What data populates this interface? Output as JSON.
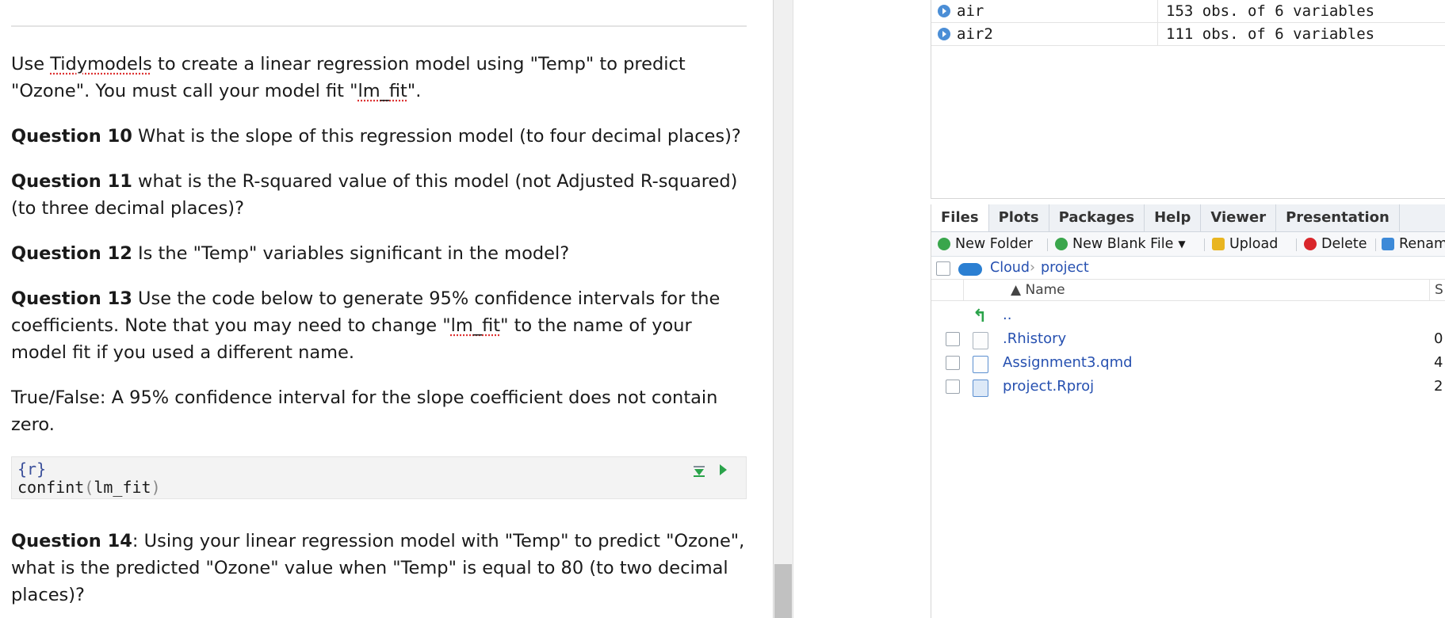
{
  "editor": {
    "intro_part1": "Use ",
    "intro_link": "Tidymodels",
    "intro_part2": " to create a linear regression model using \"Temp\" to predict \"Ozone\". You must call your model fit \"",
    "intro_lm": "lm_fit",
    "intro_part3": "\".",
    "q10_label": "Question 10",
    "q10_text": " What is the slope of this regression model (to four decimal places)?",
    "q11_label": "Question 11",
    "q11_text": " what is the R-squared value of this model (not Adjusted R-squared) (to three decimal places)?",
    "q12_label": "Question 12",
    "q12_text": " Is the \"Temp\" variables significant in the model?",
    "q13_label": "Question 13",
    "q13_part1": " Use the code below to generate 95% confidence intervals for the coefficients. Note that you may need to change \"",
    "q13_lm": "lm_fit",
    "q13_part2": "\" to the name of your model fit if you used a different name.",
    "tf_text": "True/False: A 95% confidence interval for the slope coefficient does not contain zero.",
    "chunk_header": "{r}",
    "chunk_code_fn": "confint",
    "chunk_code_open": "(",
    "chunk_code_arg": "lm_fit",
    "chunk_code_close": ")",
    "q14_label": "Question 14",
    "q14_text": ": Using your linear regression model with \"Temp\" to predict \"Ozone\", what is the predicted \"Ozone\" value when \"Temp\" is equal to 80 (to two decimal places)?"
  },
  "environment": {
    "rows": [
      {
        "name": "air",
        "value": "153 obs. of 6 variables"
      },
      {
        "name": "air2",
        "value": "111 obs. of 6 variables"
      }
    ]
  },
  "files_pane": {
    "tabs": [
      "Files",
      "Plots",
      "Packages",
      "Help",
      "Viewer",
      "Presentation"
    ],
    "toolbar": {
      "new_folder": "New Folder",
      "new_blank_file": "New Blank File",
      "upload": "Upload",
      "delete": "Delete",
      "rename": "Renam"
    },
    "path": {
      "cloud": "Cloud",
      "sep": "›",
      "project": "project"
    },
    "columns": {
      "name": "▲ Name",
      "size": "S"
    },
    "up_label": "..",
    "files": [
      {
        "name": ".Rhistory",
        "size": "0"
      },
      {
        "name": "Assignment3.qmd",
        "size": "4"
      },
      {
        "name": "project.Rproj",
        "size": "2"
      }
    ]
  }
}
